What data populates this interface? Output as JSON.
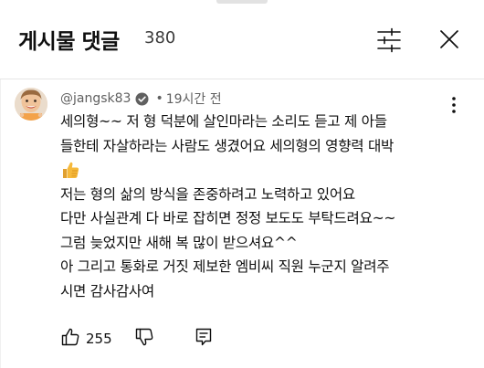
{
  "header": {
    "title": "게시물 댓글",
    "count": "380"
  },
  "comment": {
    "author": "@jangsk83",
    "separator": "•",
    "time": "19시간 전",
    "lines": [
      "세의형~~ 저 형 덕분에 살인마라는 소리도 듣고 제 아들",
      "들한테 자살하라는 사람도 생겼어요 세의형의 영향력 대박",
      "저는 형의 삶의 방식을 존중하려고 노력하고 있어요",
      "다만 사실관계 다 바로 잡히면 정정 보도도 부탁드려요~~",
      "그럼 늦었지만 새해 복 많이 받으셔요^^",
      "아 그리고 통화로 거짓 제보한 엠비씨 직원 누군지 알려주",
      "시면 감사감사여"
    ],
    "emoji": "thumbs-up-emoji",
    "like_count": "255"
  },
  "icons": {
    "filter": "sliders-icon",
    "close": "close-icon",
    "verified": "verified-check-icon",
    "menu": "vertical-dots-icon",
    "like": "thumbs-up-icon",
    "dislike": "thumbs-down-icon",
    "reply": "reply-icon"
  },
  "colors": {
    "text": "#0f0f0f",
    "secondary": "#606060",
    "divider": "#e5e5e5",
    "emoji": "#f6b93b"
  }
}
